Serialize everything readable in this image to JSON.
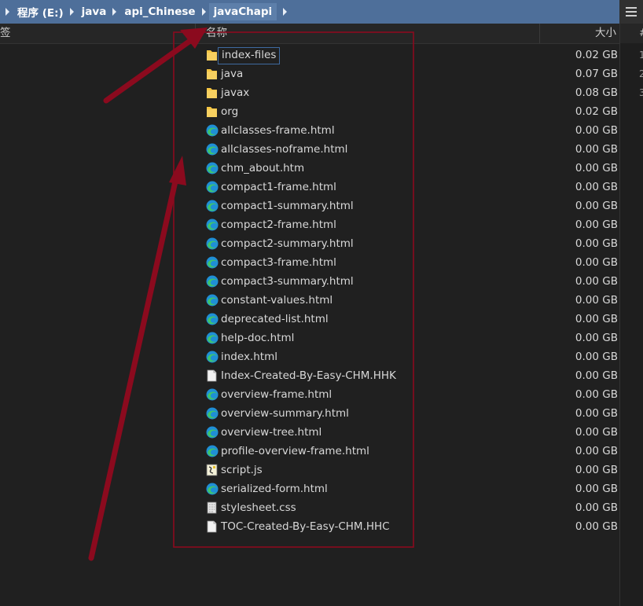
{
  "breadcrumb": [
    "程序 (E:)",
    "java",
    "api_Chinese",
    "javaChapi"
  ],
  "columns": {
    "tag": "签",
    "name": "名称",
    "size": "大小"
  },
  "right_pane": {
    "header": "#",
    "numbers": [
      "1",
      "2",
      "3"
    ]
  },
  "files": [
    {
      "name": "index-files",
      "size": "0.02 GB",
      "icon": "folder-icon",
      "focused": true
    },
    {
      "name": "java",
      "size": "0.07 GB",
      "icon": "folder-icon"
    },
    {
      "name": "javax",
      "size": "0.08 GB",
      "icon": "folder-icon"
    },
    {
      "name": "org",
      "size": "0.02 GB",
      "icon": "folder-icon"
    },
    {
      "name": "allclasses-frame.html",
      "size": "0.00 GB",
      "icon": "edge-browser-icon"
    },
    {
      "name": "allclasses-noframe.html",
      "size": "0.00 GB",
      "icon": "edge-browser-icon"
    },
    {
      "name": "chm_about.htm",
      "size": "0.00 GB",
      "icon": "edge-browser-icon"
    },
    {
      "name": "compact1-frame.html",
      "size": "0.00 GB",
      "icon": "edge-browser-icon"
    },
    {
      "name": "compact1-summary.html",
      "size": "0.00 GB",
      "icon": "edge-browser-icon"
    },
    {
      "name": "compact2-frame.html",
      "size": "0.00 GB",
      "icon": "edge-browser-icon"
    },
    {
      "name": "compact2-summary.html",
      "size": "0.00 GB",
      "icon": "edge-browser-icon"
    },
    {
      "name": "compact3-frame.html",
      "size": "0.00 GB",
      "icon": "edge-browser-icon"
    },
    {
      "name": "compact3-summary.html",
      "size": "0.00 GB",
      "icon": "edge-browser-icon"
    },
    {
      "name": "constant-values.html",
      "size": "0.00 GB",
      "icon": "edge-browser-icon"
    },
    {
      "name": "deprecated-list.html",
      "size": "0.00 GB",
      "icon": "edge-browser-icon"
    },
    {
      "name": "help-doc.html",
      "size": "0.00 GB",
      "icon": "edge-browser-icon"
    },
    {
      "name": "index.html",
      "size": "0.00 GB",
      "icon": "edge-browser-icon"
    },
    {
      "name": "Index-Created-By-Easy-CHM.HHK",
      "size": "0.00 GB",
      "icon": "blank-file-icon"
    },
    {
      "name": "overview-frame.html",
      "size": "0.00 GB",
      "icon": "edge-browser-icon"
    },
    {
      "name": "overview-summary.html",
      "size": "0.00 GB",
      "icon": "edge-browser-icon"
    },
    {
      "name": "overview-tree.html",
      "size": "0.00 GB",
      "icon": "edge-browser-icon"
    },
    {
      "name": "profile-overview-frame.html",
      "size": "0.00 GB",
      "icon": "edge-browser-icon"
    },
    {
      "name": "script.js",
      "size": "0.00 GB",
      "icon": "script-file-icon"
    },
    {
      "name": "serialized-form.html",
      "size": "0.00 GB",
      "icon": "edge-browser-icon"
    },
    {
      "name": "stylesheet.css",
      "size": "0.00 GB",
      "icon": "css-file-icon"
    },
    {
      "name": "TOC-Created-By-Easy-CHM.HHC",
      "size": "0.00 GB",
      "icon": "blank-file-icon"
    }
  ],
  "colors": {
    "breadcrumb_bar": "#4e6f9a",
    "background": "#202020",
    "annotation": "#8b0a1e",
    "folder": "#f5c542",
    "edge_blue": "#1f8fd6",
    "edge_green": "#3ec46d"
  }
}
